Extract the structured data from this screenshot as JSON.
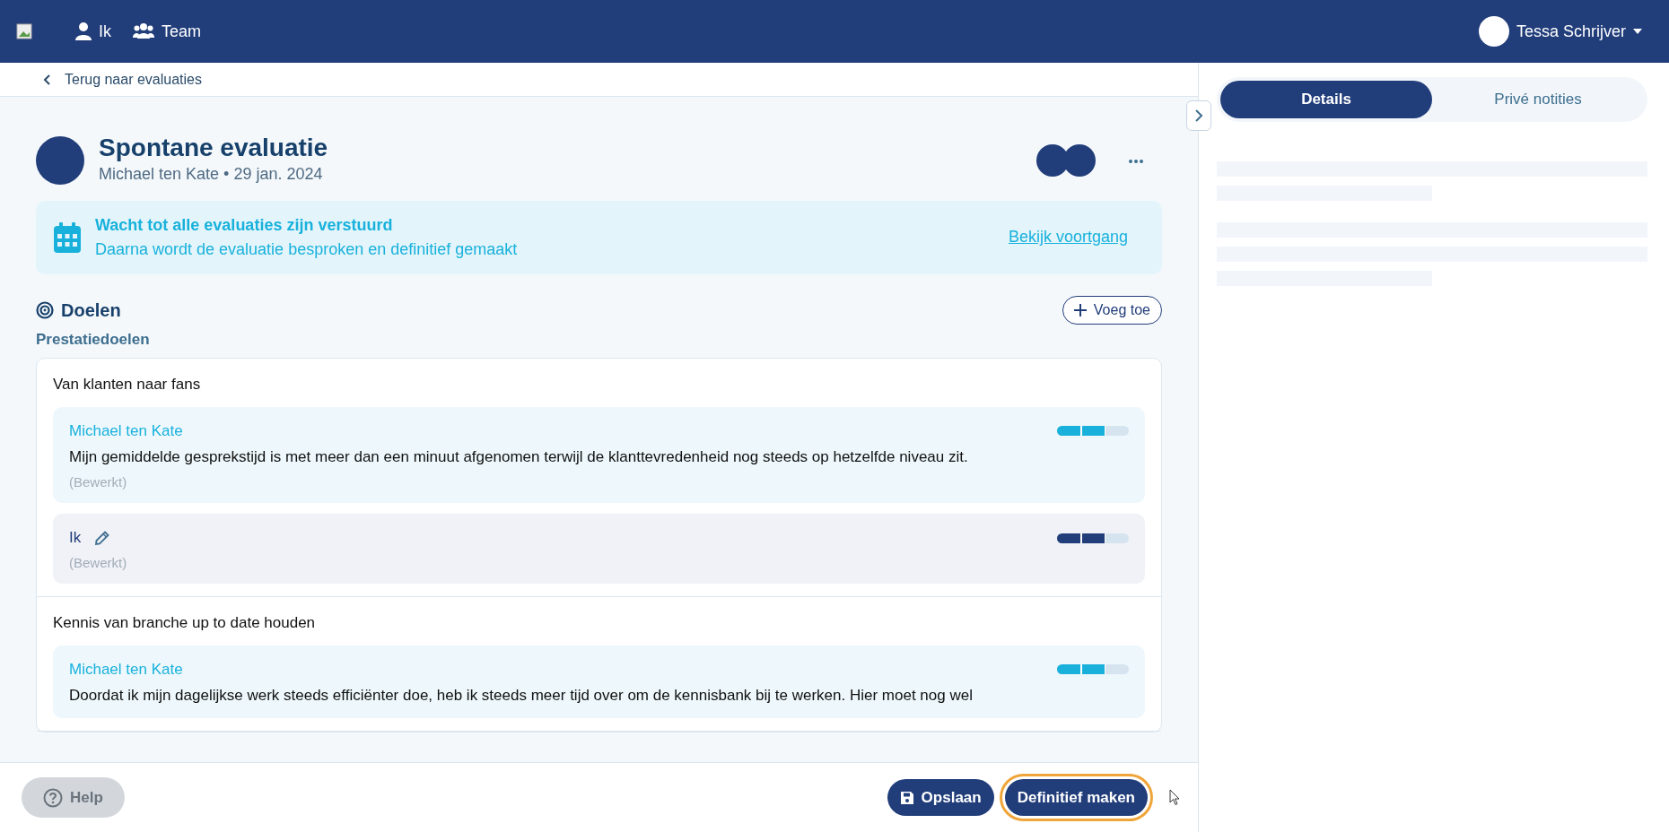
{
  "header": {
    "nav": [
      "Ik",
      "Team"
    ],
    "user": "Tessa Schrijver"
  },
  "back_link": "Terug naar evaluaties",
  "evaluation": {
    "title": "Spontane evaluatie",
    "subtitle": "Michael ten Kate • 29 jan. 2024"
  },
  "notice": {
    "title": "Wacht tot alle evaluaties zijn verstuurd",
    "text": "Daarna wordt de evaluatie besproken en definitief gemaakt",
    "link": "Bekijk voortgang"
  },
  "goals": {
    "heading": "Doelen",
    "add_button": "Voeg toe",
    "section": "Prestatiedoelen",
    "items": [
      {
        "title": "Van klanten naar fans",
        "comments": [
          {
            "kind": "other",
            "author": "Michael ten Kate",
            "text": "Mijn gemiddelde gesprekstijd is met meer dan een minuut afgenomen terwijl de klanttevredenheid nog steeds op hetzelfde niveau zit.",
            "note": "(Bewerkt)",
            "level": 0.667
          },
          {
            "kind": "self",
            "author": "Ik",
            "note": "(Bewerkt)",
            "level": 0.667
          }
        ]
      },
      {
        "title": "Kennis van branche up to date houden",
        "comments": [
          {
            "kind": "other",
            "author": "Michael ten Kate",
            "text": "Doordat ik mijn dagelijkse werk steeds efficiënter doe, heb ik steeds meer tijd over om de kennisbank bij te werken. Hier moet nog wel",
            "level": 0.667
          }
        ]
      }
    ]
  },
  "footer": {
    "help": "Help",
    "save": "Opslaan",
    "finalize": {
      "label": "Definitief maken",
      "focused": true
    }
  },
  "side_panel": {
    "tabs": [
      {
        "label": "Details",
        "selected": true
      },
      {
        "label": "Privé notities",
        "selected": false
      }
    ]
  }
}
